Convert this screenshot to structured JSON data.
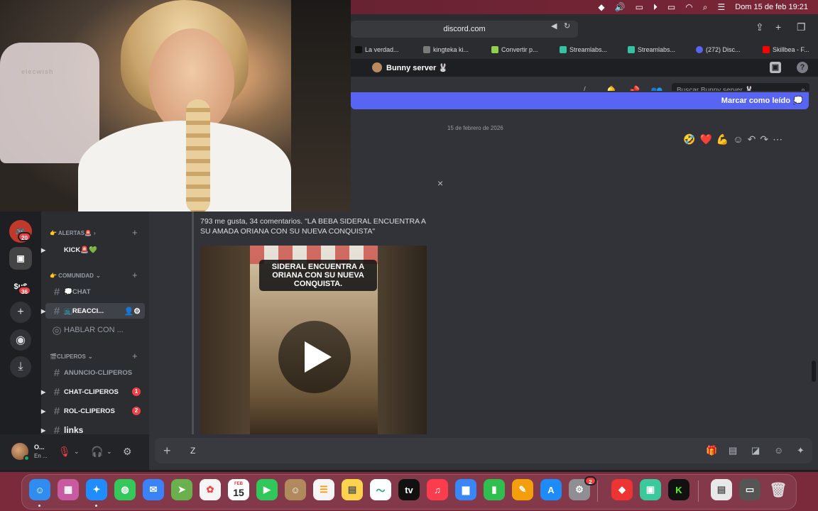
{
  "menubar": {
    "date_time": "Dom 15 de feb  19:21",
    "icons": [
      "dropbox-icon",
      "volume-icon",
      "screen-mirror-icon",
      "play-icon",
      "battery-icon",
      "wifi-icon",
      "search-icon",
      "control-center-icon"
    ]
  },
  "browser": {
    "url": "discord.com",
    "bookmarks": [
      {
        "label": "La verdad...",
        "color": "#111111"
      },
      {
        "label": "kingteka ki...",
        "color": "#7a7a7a"
      },
      {
        "label": "Convertir p...",
        "color": "#8fd14f"
      },
      {
        "label": "Streamlabs...",
        "color": "#31c3a2"
      },
      {
        "label": "Streamlabs...",
        "color": "#31c3a2"
      },
      {
        "label": "(272) Disc...",
        "color": "#5865f2"
      },
      {
        "label": "Skillbea - F...",
        "color": "#ff0000"
      }
    ]
  },
  "discord": {
    "server_title": "Bunny server 🐰",
    "search_placeholder": "Buscar Bunny server 🐰",
    "mark_read": "Marcar como leído",
    "date_divider": "15 de febrero de 2026",
    "reactions": [
      "🤣",
      "❤️",
      "💪"
    ],
    "embed": {
      "text": "793 me gusta, 34 comentarios. \"LA BEBA SIDERAL ENCUENTRA A SU AMADA ORIANA CON SU NUEVA CONQUISTA\"",
      "video_caption": "SIDERAL ENCUENTRA A ORIANA CON SU NUEVA CONQUISTA.",
      "close": "×"
    },
    "composer": {
      "typed": "Z",
      "plus": "+"
    },
    "rail_badges": {
      "a": "20",
      "b": "36"
    },
    "rail_text": {
      "kick_tag": "$u$"
    },
    "categories": [
      {
        "label": "👉 ALERTAS🚨",
        "caret": "›"
      },
      {
        "label": "👉 COMUNIDAD",
        "caret": "⌄"
      },
      {
        "label": "🎬CLIPEROS",
        "caret": "⌄"
      }
    ],
    "channels": [
      {
        "label": "KICK🚨💚"
      },
      {
        "label": "💭CHAT"
      },
      {
        "label": "📺REACCI..."
      },
      {
        "label": "HABLAR CON ..."
      },
      {
        "label": "ANUNCIO-CLIPEROS"
      },
      {
        "label": "CHAT-CLIPEROS",
        "badge": "1"
      },
      {
        "label": "ROL-CLIPEROS",
        "badge": "2"
      },
      {
        "label": "links"
      }
    ],
    "user": {
      "name": "O...",
      "status": "En ..."
    }
  },
  "webcam": {
    "chair_text": "elecwish"
  },
  "dock": {
    "calendar_month": "FEB",
    "calendar_day": "15",
    "settings_badge": "2"
  },
  "colors": {
    "blurple": "#5865f2",
    "danger": "#f23f43",
    "online": "#23a55a"
  }
}
